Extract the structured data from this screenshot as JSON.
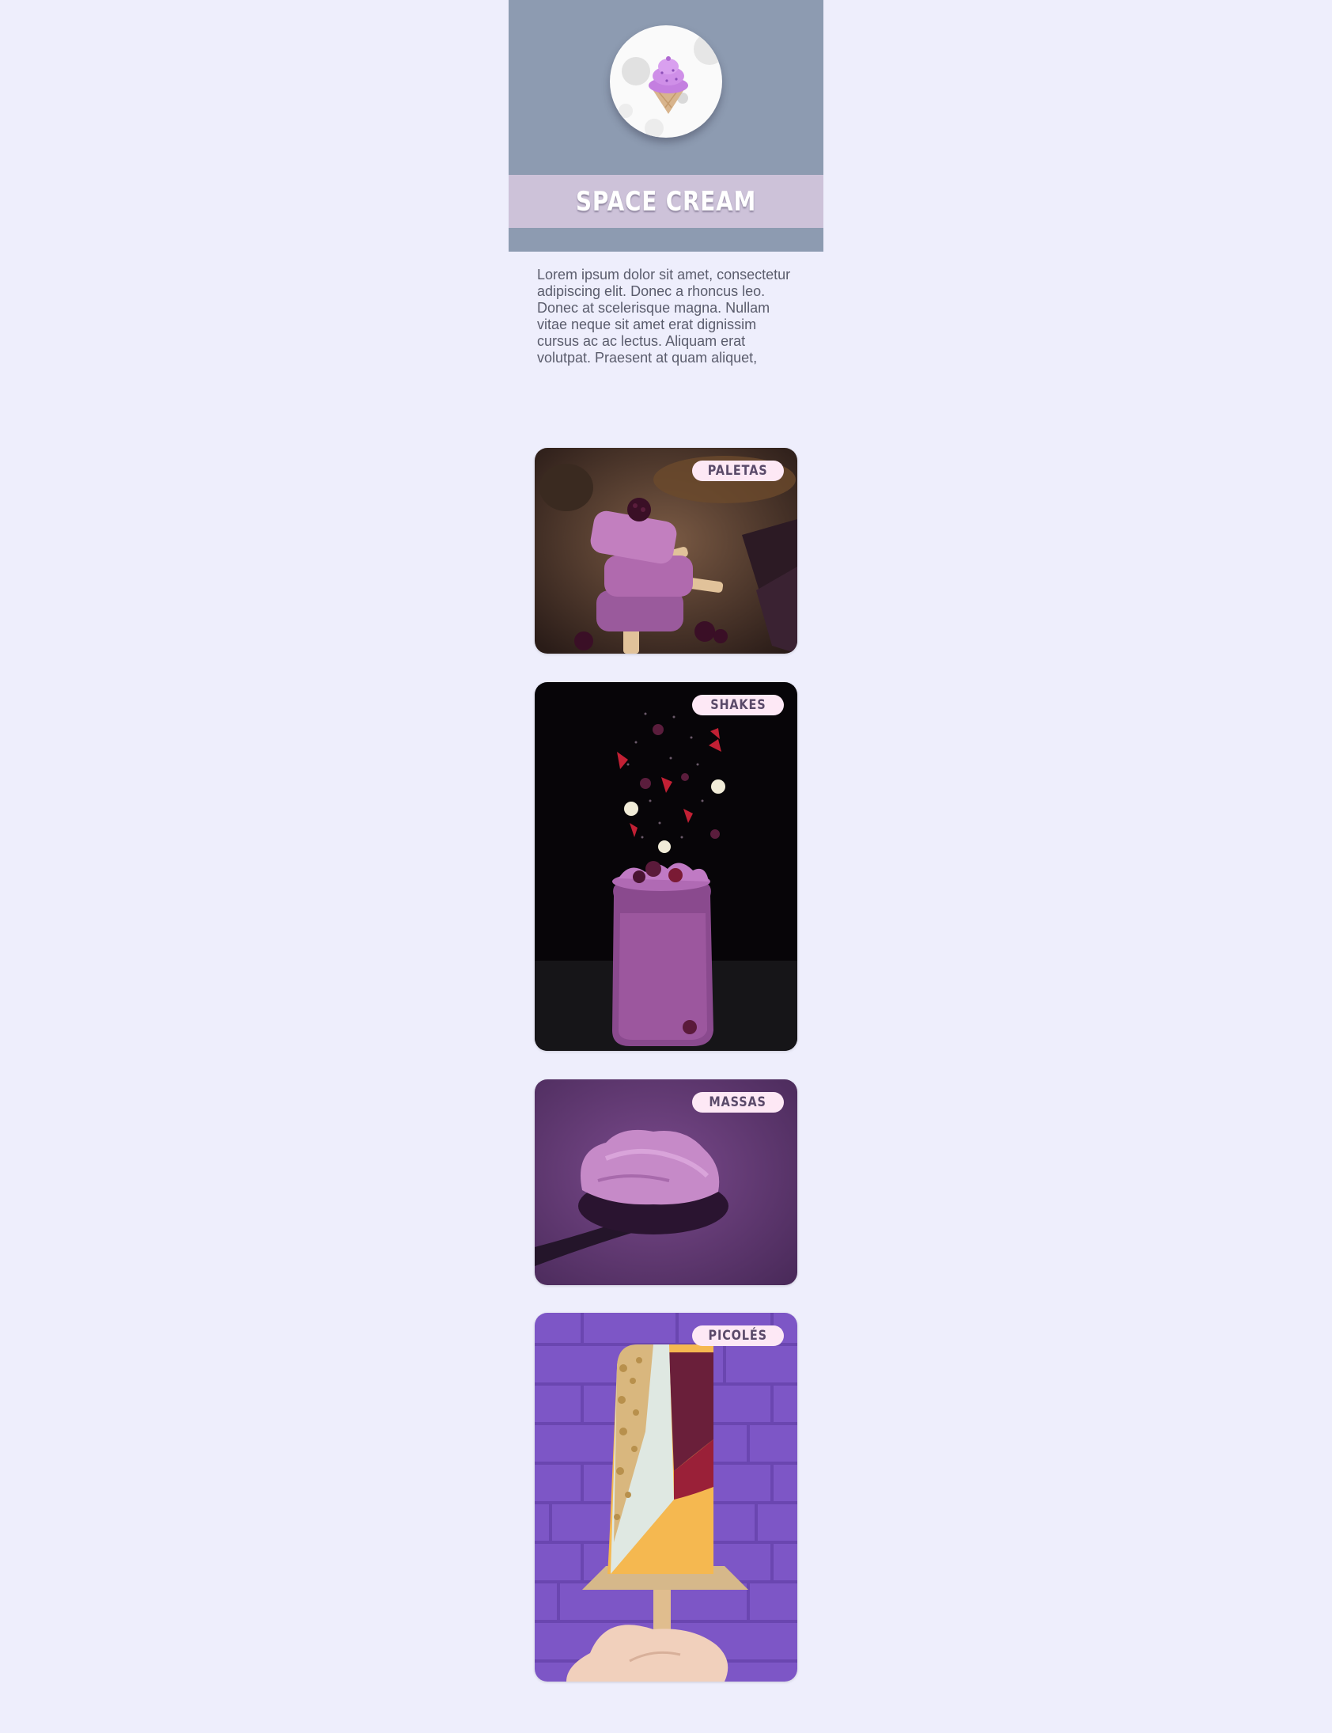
{
  "brand": {
    "name": "SPACE CREAM",
    "logo_icon": "ice-cream-cone-icon"
  },
  "intro": {
    "text": "Lorem ipsum dolor sit amet, consectetur adipiscing elit. Donec a rhoncus leo. Donec at scelerisque magna. Nullam vitae neque sit amet erat dignissim cursus ac ac lectus. Aliquam erat volutpat. Praesent at quam aliquet,"
  },
  "categories": [
    {
      "label": "PALETAS"
    },
    {
      "label": "SHAKES"
    },
    {
      "label": "MASSAS"
    },
    {
      "label": "PICOLÉS"
    }
  ],
  "colors": {
    "page_background": "#eeeefc",
    "hero_background": "#8d9bb1",
    "title_band": "#cdc2d9",
    "pill_background": "#fde8f5",
    "pill_text": "#5a4a6a"
  }
}
